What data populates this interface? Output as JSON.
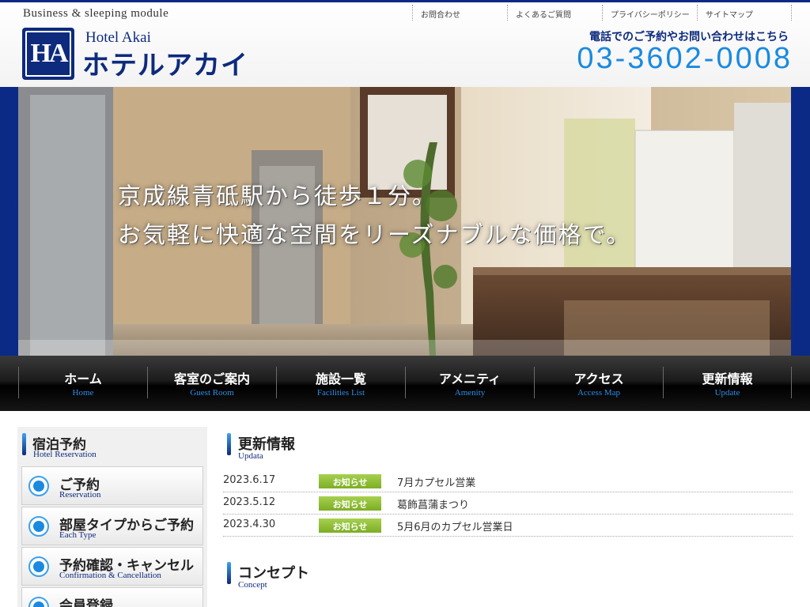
{
  "header": {
    "tagline": "Business & sleeping module",
    "logo_text": "HA",
    "brand_en": "Hotel Akai",
    "brand_ja": "ホテルアカイ",
    "util_nav": [
      "お問合わせ",
      "よくあるご質問",
      "プライバシーポリシー",
      "サイトマップ"
    ],
    "phone_lead": "電話でのご予約やお問い合わせはこちら",
    "phone_number": "03-3602-0008"
  },
  "hero": {
    "line1": "京成線青砥駅から徒歩１分。",
    "line2": "お気軽に快適な空間をリーズナブルな価格で。"
  },
  "gnav": [
    {
      "ja": "ホーム",
      "en": "Home"
    },
    {
      "ja": "客室のご案内",
      "en": "Guest Room"
    },
    {
      "ja": "施設一覧",
      "en": "Facilities List"
    },
    {
      "ja": "アメニティ",
      "en": "Amenity"
    },
    {
      "ja": "アクセス",
      "en": "Access Map"
    },
    {
      "ja": "更新情報",
      "en": "Update"
    }
  ],
  "sidebar": {
    "heading_ja": "宿泊予約",
    "heading_en": "Hotel Reservation",
    "buttons": [
      {
        "ja": "ご予約",
        "en": "Reservation"
      },
      {
        "ja": "部屋タイプからご予約",
        "en": "Each Type"
      },
      {
        "ja": "予約確認・キャンセル",
        "en": "Confirmation & Cancellation"
      },
      {
        "ja": "会員登録",
        "en": ""
      }
    ]
  },
  "news": {
    "heading_ja": "更新情報",
    "heading_en": "Updata",
    "items": [
      {
        "date": "2023.6.17",
        "badge": "お知らせ",
        "title": "7月カプセル営業"
      },
      {
        "date": "2023.5.12",
        "badge": "お知らせ",
        "title": "葛飾菖蒲まつり"
      },
      {
        "date": "2023.4.30",
        "badge": "お知らせ",
        "title": "5月6月のカプセル営業日"
      }
    ]
  },
  "concept": {
    "heading_ja": "コンセプト",
    "heading_en": "Concept"
  },
  "colors": {
    "brand_navy": "#0d2a7d",
    "phone_blue": "#1a8ae0",
    "badge_green": "#8ec03a"
  }
}
